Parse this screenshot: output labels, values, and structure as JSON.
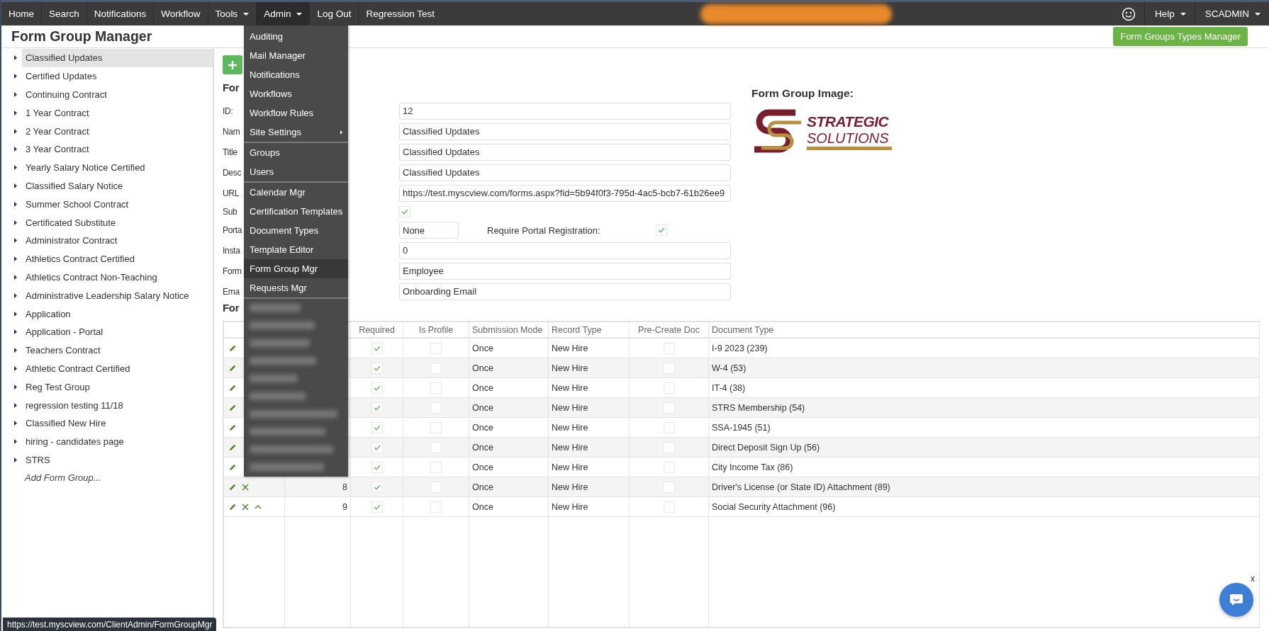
{
  "nav": {
    "items": [
      {
        "label": "Home",
        "kind": "link",
        "selected": false
      },
      {
        "label": "Search",
        "kind": "link",
        "selected": false
      },
      {
        "label": "Notifications",
        "kind": "link",
        "selected": false
      },
      {
        "label": "Workflow",
        "kind": "link",
        "selected": false
      },
      {
        "label": "Tools",
        "kind": "dropdown",
        "selected": false
      },
      {
        "label": "Admin",
        "kind": "dropdown",
        "selected": true
      },
      {
        "label": "Log Out",
        "kind": "link",
        "selected": false
      },
      {
        "label": "Regression Test",
        "kind": "label",
        "selected": false
      }
    ],
    "right": [
      {
        "label": "Help",
        "kind": "dropdown",
        "selected": false
      },
      {
        "label": "SCADMIN",
        "kind": "dropdown",
        "selected": false
      }
    ]
  },
  "header": {
    "title": "Form Group Manager",
    "types_button": "Form Groups Types Manager"
  },
  "sidebar": {
    "items": [
      {
        "label": "Classified Updates",
        "selected": true
      },
      {
        "label": "Certified Updates",
        "selected": false
      },
      {
        "label": "Continuing Contract",
        "selected": false
      },
      {
        "label": "1 Year Contract",
        "selected": false
      },
      {
        "label": "2 Year Contract",
        "selected": false
      },
      {
        "label": "3 Year Contract",
        "selected": false
      },
      {
        "label": "Yearly Salary Notice Certified",
        "selected": false
      },
      {
        "label": "Classified Salary Notice",
        "selected": false
      },
      {
        "label": "Summer School Contract",
        "selected": false
      },
      {
        "label": "Certificated Substitute",
        "selected": false
      },
      {
        "label": "Administrator Contract",
        "selected": false
      },
      {
        "label": "Athletics Contract Certified",
        "selected": false
      },
      {
        "label": "Athletics Contract Non-Teaching",
        "selected": false
      },
      {
        "label": "Administrative Leadership Salary Notice",
        "selected": false
      },
      {
        "label": "Application",
        "selected": false
      },
      {
        "label": "Application - Portal",
        "selected": false
      },
      {
        "label": "Teachers Contract",
        "selected": false
      },
      {
        "label": "Athletic Contract Certified",
        "selected": false
      },
      {
        "label": "Reg Test Group",
        "selected": false
      },
      {
        "label": "regression testing 11/18",
        "selected": false
      },
      {
        "label": "Classified New Hire",
        "selected": false
      },
      {
        "label": "hiring - candidates page",
        "selected": false
      },
      {
        "label": "STRS",
        "selected": false
      }
    ],
    "add_link": "Add Form Group..."
  },
  "form": {
    "heading": "For",
    "fields": [
      {
        "label": "ID:",
        "kind": "text",
        "value": "12"
      },
      {
        "label": "Nam",
        "kind": "text",
        "value": "Classified Updates"
      },
      {
        "label": "Title",
        "kind": "text",
        "value": "Classified Updates"
      },
      {
        "label": "Desc",
        "kind": "text",
        "value": "Classified Updates"
      },
      {
        "label": "URL",
        "kind": "text",
        "value": "https://test.myscview.com/forms.aspx?fid=5b94f0f3-795d-4ac5-bcb7-61b26ee9"
      },
      {
        "label": "Sub",
        "kind": "checkbox",
        "checked": true
      },
      {
        "label": "Porta",
        "kind": "portal",
        "value": "None",
        "extra_label": "Require Portal Registration:",
        "extra_checked": true
      },
      {
        "label": "Insta",
        "kind": "text",
        "value": "0"
      },
      {
        "label": "Form",
        "kind": "text",
        "value": "Employee"
      },
      {
        "label": "Ema",
        "kind": "text",
        "value": "Onboarding Email"
      }
    ],
    "image_label": "Form Group Image:",
    "logo": {
      "line1": "STRATEGIC",
      "line2": "SOLUTIONS"
    }
  },
  "forms": {
    "heading": "For",
    "columns": [
      "Required",
      "Is Profile",
      "Submission Mode",
      "Record Type",
      "Pre-Create Doc",
      "Document Type"
    ],
    "rows": [
      {
        "actions": [
          {
            "kind": "edit"
          }
        ],
        "required": true,
        "is_profile": false,
        "submission_mode": "Once",
        "record_type": "New Hire",
        "pre_create_doc": false,
        "document_type": "I-9 2023 (239)"
      },
      {
        "actions": [
          {
            "kind": "edit"
          }
        ],
        "required": true,
        "is_profile": false,
        "submission_mode": "Once",
        "record_type": "New Hire",
        "pre_create_doc": false,
        "document_type": "W-4 (53)"
      },
      {
        "actions": [
          {
            "kind": "edit"
          }
        ],
        "required": true,
        "is_profile": false,
        "submission_mode": "Once",
        "record_type": "New Hire",
        "pre_create_doc": false,
        "document_type": "IT-4 (38)"
      },
      {
        "actions": [
          {
            "kind": "edit"
          }
        ],
        "required": true,
        "is_profile": false,
        "submission_mode": "Once",
        "record_type": "New Hire",
        "pre_create_doc": false,
        "document_type": "STRS Membership (54)"
      },
      {
        "actions": [
          {
            "kind": "edit"
          }
        ],
        "required": true,
        "is_profile": false,
        "submission_mode": "Once",
        "record_type": "New Hire",
        "pre_create_doc": false,
        "document_type": "SSA-1945 (51)"
      },
      {
        "actions": [
          {
            "kind": "edit"
          }
        ],
        "required": true,
        "is_profile": false,
        "submission_mode": "Once",
        "record_type": "New Hire",
        "pre_create_doc": false,
        "document_type": "Direct Deposit Sign Up (56)"
      },
      {
        "actions": [
          {
            "kind": "edit"
          }
        ],
        "required": true,
        "is_profile": false,
        "submission_mode": "Once",
        "record_type": "New Hire",
        "pre_create_doc": false,
        "document_type": "City Income Tax (86)"
      },
      {
        "actions": [
          {
            "kind": "edit"
          },
          {
            "kind": "delete"
          }
        ],
        "order": "8",
        "required": true,
        "is_profile": false,
        "submission_mode": "Once",
        "record_type": "New Hire",
        "pre_create_doc": false,
        "document_type": "Driver's License (or State ID) Attachment (89)"
      },
      {
        "actions": [
          {
            "kind": "edit"
          },
          {
            "kind": "delete"
          },
          {
            "kind": "move_up"
          }
        ],
        "order": "9",
        "required": true,
        "is_profile": false,
        "submission_mode": "Once",
        "record_type": "New Hire",
        "pre_create_doc": false,
        "document_type": "Social Security Attachment (96)"
      }
    ]
  },
  "admin_menu": {
    "items": [
      {
        "kind": "item",
        "label": "Auditing",
        "selected": false
      },
      {
        "kind": "item",
        "label": "Mail Manager",
        "selected": false
      },
      {
        "kind": "item",
        "label": "Notifications",
        "selected": false
      },
      {
        "kind": "item",
        "label": "Workflows",
        "selected": false
      },
      {
        "kind": "item",
        "label": "Workflow Rules",
        "selected": false
      },
      {
        "kind": "submenu",
        "label": "Site Settings",
        "selected": false
      },
      {
        "kind": "divider"
      },
      {
        "kind": "item",
        "label": "Groups",
        "selected": false
      },
      {
        "kind": "item",
        "label": "Users",
        "selected": false
      },
      {
        "kind": "divider"
      },
      {
        "kind": "item",
        "label": "Calendar Mgr",
        "selected": false
      },
      {
        "kind": "item",
        "label": "Certification Templates",
        "selected": false
      },
      {
        "kind": "item",
        "label": "Document Types",
        "selected": false
      },
      {
        "kind": "item",
        "label": "Template Editor",
        "selected": false
      },
      {
        "kind": "item",
        "label": "Form Group Mgr",
        "selected": true
      },
      {
        "kind": "item",
        "label": "Requests Mgr",
        "selected": false
      },
      {
        "kind": "divider"
      },
      {
        "kind": "redacted"
      },
      {
        "kind": "redacted"
      },
      {
        "kind": "redacted"
      },
      {
        "kind": "redacted"
      },
      {
        "kind": "redacted"
      },
      {
        "kind": "redacted"
      },
      {
        "kind": "redacted"
      },
      {
        "kind": "redacted"
      },
      {
        "kind": "redacted"
      },
      {
        "kind": "redacted"
      }
    ]
  },
  "status_url": "https://test.myscview.com/ClientAdmin/FormGroupMgr",
  "chat": {
    "close": "x"
  }
}
